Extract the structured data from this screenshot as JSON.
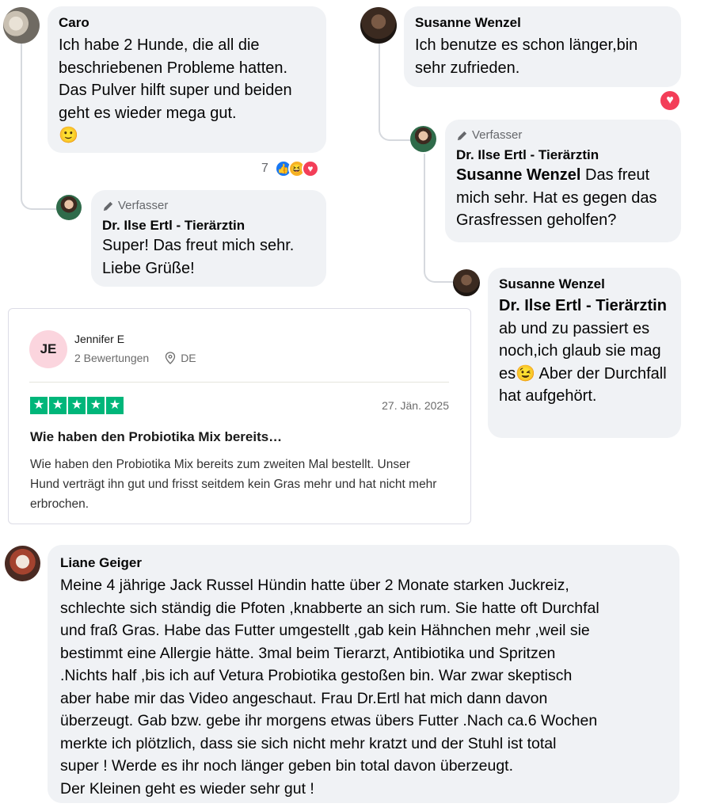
{
  "comments": {
    "caro": {
      "name": "Caro",
      "text": "Ich habe 2 Hunde, die all die beschriebenen Probleme hatten. Das Pulver hilft super und beiden geht es wieder mega gut.",
      "emoji": "🙂",
      "reaction_count": "7"
    },
    "ilse_reply_caro": {
      "badge": "Verfasser",
      "name": "Dr. Ilse Ertl - Tierärztin",
      "text": "Super! Das freut mich sehr. Liebe Grüße!"
    },
    "susanne": {
      "name": "Susanne Wenzel",
      "text": "Ich benutze es schon länger,bin sehr zufrieden."
    },
    "ilse_reply_susanne": {
      "badge": "Verfasser",
      "name": "Dr. Ilse Ertl - Tierärztin",
      "mention": "Susanne Wenzel",
      "text": " Das freut mich sehr. Hat es gegen das Grasfressen geholfen?"
    },
    "susanne_reply": {
      "name": "Susanne Wenzel",
      "mention": "Dr. Ilse Ertl - Tierärztin",
      "text": " ab und zu passiert es noch,ich glaub sie mag es",
      "emoji": "😉",
      "text2": " Aber der Durchfall hat aufgehört."
    },
    "liane": {
      "name": "Liane Geiger",
      "lines": [
        "Meine 4 jährige Jack Russel Hündin hatte über 2 Monate starken Juckreiz,",
        "schlechte sich ständig die Pfoten ,knabberte an sich rum. Sie hatte oft Durchfal",
        "und fraß Gras. Habe das Futter umgestellt ,gab kein Hähnchen mehr ,weil sie",
        "bestimmt eine Allergie hätte. 3mal beim Tierarzt, Antibiotika und Spritzen",
        ".Nichts half ,bis ich auf Vetura Probiotika gestoßen bin. War zwar skeptisch",
        "aber habe mir das Video angeschaut. Frau Dr.Ertl hat mich dann davon",
        "überzeugt. Gab bzw. gebe ihr morgens etwas übers Futter .Nach ca.6 Wochen",
        "merkte ich plötzlich, dass sie sich nicht mehr kratzt und der Stuhl ist total",
        "super ! Werde es ihr noch länger geben bin total davon überzeugt.",
        "Der Kleinen geht es wieder sehr gut !"
      ]
    }
  },
  "review": {
    "initials": "JE",
    "name": "Jennifer E",
    "count": "2 Bewertungen",
    "country": "DE",
    "stars": 5,
    "date": "27. Jän. 2025",
    "title": "Wie haben den Probiotika Mix bereits…",
    "body": "Wie haben den Probiotika Mix bereits zum zweiten Mal bestellt. Unser Hund verträgt ihn gut und frisst seitdem kein Gras mehr und hat nicht mehr erbrochen."
  },
  "colors": {
    "bubble": "#f0f2f5",
    "trustpilot_green": "#00b67a",
    "like_blue": "#1877f2",
    "love_red": "#f33e58"
  }
}
